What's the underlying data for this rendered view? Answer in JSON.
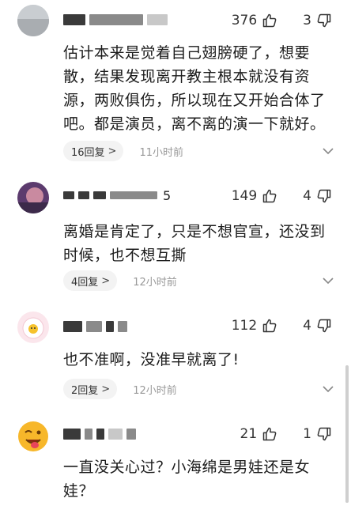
{
  "comments": [
    {
      "username_tail": "",
      "likes": "376",
      "dislikes": "3",
      "text": "估计本来是觉着自己翅膀硬了，想要散，结果发现离开教主根本就没有资源，两败俱伤，所以现在又开始合体了吧。都是演员，离不离的演一下就好。",
      "replies": "16回复",
      "time": "11小时前"
    },
    {
      "username_tail": "5",
      "likes": "149",
      "dislikes": "4",
      "text": "离婚是肯定了，只是不想官宣，还没到时候，也不想互撕",
      "replies": "4回复",
      "time": "12小时前"
    },
    {
      "username_tail": "",
      "likes": "112",
      "dislikes": "4",
      "text": "也不准啊，没准早就离了!",
      "replies": "2回复",
      "time": "12小时前"
    },
    {
      "username_tail": "",
      "likes": "21",
      "dislikes": "1",
      "text": "一直没关心过？小海绵是男娃还是女娃？"
    }
  ]
}
